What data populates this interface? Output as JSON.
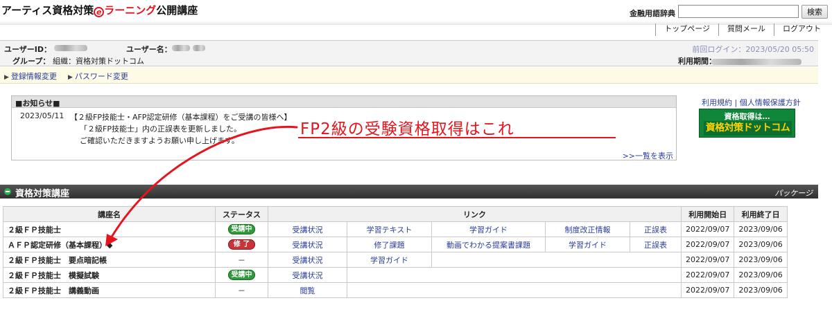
{
  "header": {
    "logo": {
      "part1": "アーティス資格対策",
      "e": "e",
      "part2": "ラーニング",
      "part3": "公開講座"
    },
    "dict_label": "金融用語辞典",
    "dict_input_value": "",
    "search_button": "検索"
  },
  "topnav": [
    "トップページ",
    "質問メール",
    "ログアウト"
  ],
  "user": {
    "id_label": "ユーザーID：",
    "name_label": "ユーザー名：",
    "group_label": "グループ：",
    "group_value": "組織：資格対策ドットコム",
    "last_login": "前回ログイン：2023/05/20 05:50",
    "period_label": "利用期間："
  },
  "account_links": [
    "登録情報変更",
    "パスワード変更"
  ],
  "notice": {
    "title": "■お知らせ■",
    "date": "2023/05/11",
    "line1": "【２級FP技能士・AFP認定研修（基本課程）をご受講の皆様へ】",
    "line2": "「２級FP技能士」内の正誤表を更新しました。",
    "line3": "ご確認いただきますようお願い申し上げます。",
    "more": ">>一覧を表示"
  },
  "side": {
    "terms": "利用規約",
    "sep": " | ",
    "privacy": "個人情報保護方針",
    "banner_top": "資格取得は…",
    "banner_bottom": "資格対策ドットコム"
  },
  "annotation": "FP2級の受験資格取得はこれ",
  "section": {
    "title": "資格対策講座",
    "package": "パッケージ"
  },
  "table": {
    "headers": {
      "name": "講座名",
      "status": "ステータス",
      "links": "リンク",
      "start": "利用開始日",
      "end": "利用終了日"
    },
    "rows": [
      {
        "name": "２級ＦＰ技能士",
        "status": "受講中",
        "status_type": "on",
        "links": [
          "受講状況",
          "学習テキスト",
          "学習ガイド",
          "制度改正情報",
          "正誤表"
        ],
        "start": "2022/09/07",
        "end": "2023/09/06"
      },
      {
        "name": "ＡＦＰ認定研修（基本課程）◆",
        "status": "修 了",
        "status_type": "done",
        "links": [
          "受講状況",
          "修了課題",
          "動画でわかる提案書課題",
          "学習ガイド",
          "正誤表"
        ],
        "start": "2022/09/07",
        "end": "2023/09/06"
      },
      {
        "name": "２級ＦＰ技能士　要点暗記帳",
        "status": "－",
        "status_type": "none",
        "links": [
          "受講状況",
          "学習ガイド"
        ],
        "start": "2022/09/07",
        "end": "2023/09/06"
      },
      {
        "name": "２級ＦＰ技能士　模擬試験",
        "status": "受講中",
        "status_type": "on",
        "links": [
          "受講状況"
        ],
        "start": "2022/09/07",
        "end": "2023/09/06"
      },
      {
        "name": "２級ＦＰ技能士　講義動画",
        "status": "－",
        "status_type": "none",
        "links": [
          "閲覧"
        ],
        "start": "2022/09/07",
        "end": "2023/09/06"
      }
    ]
  },
  "colors": {
    "link": "#2a3d9a",
    "accent_red": "#e8141c",
    "status_on": "#2e9a3a",
    "status_done": "#c9333a",
    "banner_green": "#10863a"
  }
}
